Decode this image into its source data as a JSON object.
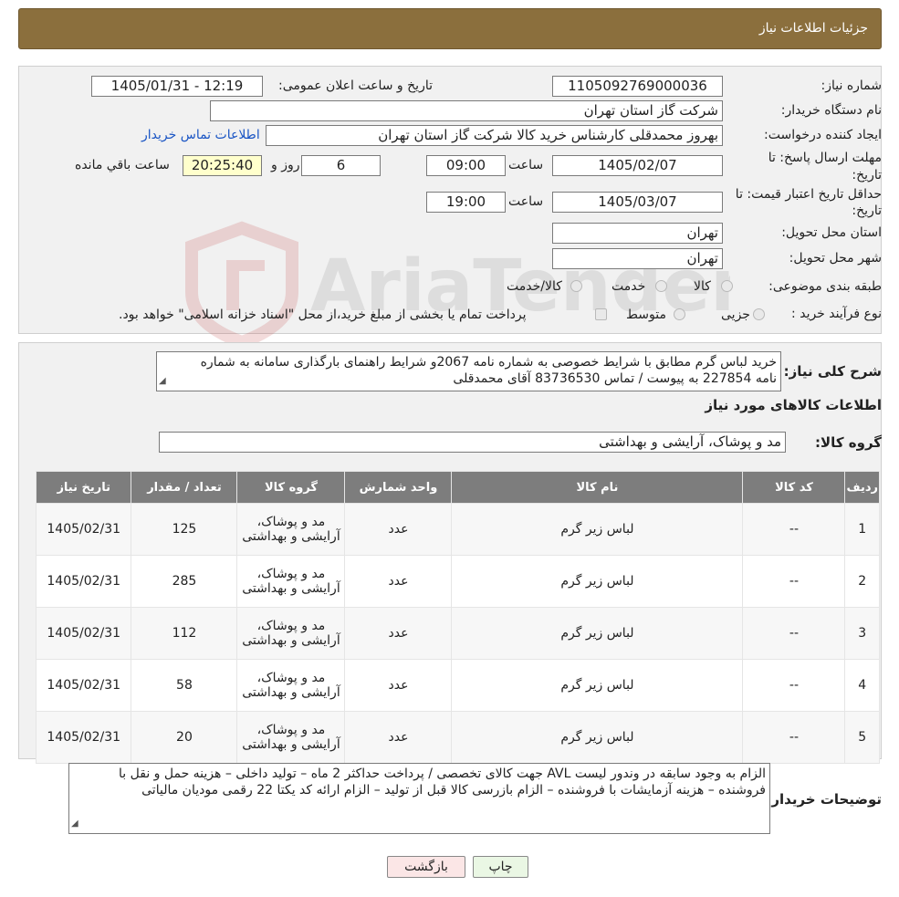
{
  "header": {
    "title": "جزئیات اطلاعات نیاز"
  },
  "fields": {
    "need_number_label": "شماره نیاز:",
    "need_number": "1105092769000036",
    "announce_label": "تاریخ و ساعت اعلان عمومی:",
    "announce_value": "1405/01/31 - 12:19",
    "buyer_org_label": "نام دستگاه خریدار:",
    "buyer_org": "شرکت گاز استان تهران",
    "creator_label": "ایجاد کننده درخواست:",
    "creator": "بهروز محمدقلی کارشناس خرید کالا شرکت گاز استان تهران",
    "contact_link": "اطلاعات تماس خریدار",
    "deadline_label_1": "مهلت ارسال پاسخ: تا",
    "deadline_label_2": "تاریخ:",
    "deadline_date": "1405/02/07",
    "time_label": "ساعت",
    "deadline_time": "09:00",
    "days_value": "6",
    "days_label": "روز و",
    "remaining_time": "20:25:40",
    "remaining_label": "ساعت باقي مانده",
    "validity_label_1": "حداقل تاريخ اعتبار قیمت: تا",
    "validity_label_2": "تاریخ:",
    "validity_date": "1405/03/07",
    "validity_time": "19:00",
    "province_label": "استان محل تحویل:",
    "province": "تهران",
    "city_label": "شهر محل تحویل:",
    "city": "تهران",
    "category_label": "طبقه بندی موضوعی:",
    "category_options": [
      "کالا",
      "خدمت",
      "کالا/خدمت"
    ],
    "process_label": "نوع فرآیند خرید :",
    "process_options": [
      "جزیی",
      "متوسط"
    ],
    "process_note": "پرداخت تمام یا بخشی از مبلغ خرید،از محل \"اسناد خزانه اسلامی\" خواهد بود."
  },
  "description": {
    "label": "شرح کلی نیاز:",
    "line1": "خرید  لباس گرم مطابق با شرایط خصوصی به شماره نامه 2067و شرایط راهنمای بارگذاری سامانه به شماره",
    "line2": "نامه 227854 به پیوست  / تماس 83736530 آقای محمدقلی"
  },
  "goods_info_title": "اطلاعات کالاهای مورد نیاز",
  "goods_group": {
    "label": "گروه کالا:",
    "value": "مد و پوشاک، آرایشی و بهداشتی"
  },
  "table": {
    "headers": [
      "ردیف",
      "کد کالا",
      "نام کالا",
      "واحد شمارش",
      "گروه کالا",
      "تعداد / مقدار",
      "تاریخ نیاز"
    ],
    "rows": [
      {
        "row": "1",
        "code": "--",
        "name": "لباس زیر گرم",
        "unit": "عدد",
        "group": "مد و پوشاک، آرایشی و بهداشتی",
        "qty": "125",
        "date": "1405/02/31"
      },
      {
        "row": "2",
        "code": "--",
        "name": "لباس زیر گرم",
        "unit": "عدد",
        "group": "مد و پوشاک، آرایشی و بهداشتی",
        "qty": "285",
        "date": "1405/02/31"
      },
      {
        "row": "3",
        "code": "--",
        "name": "لباس زیر گرم",
        "unit": "عدد",
        "group": "مد و پوشاک، آرایشی و بهداشتی",
        "qty": "112",
        "date": "1405/02/31"
      },
      {
        "row": "4",
        "code": "--",
        "name": "لباس زیر گرم",
        "unit": "عدد",
        "group": "مد و پوشاک، آرایشی و بهداشتی",
        "qty": "58",
        "date": "1405/02/31"
      },
      {
        "row": "5",
        "code": "--",
        "name": "لباس زیر گرم",
        "unit": "عدد",
        "group": "مد و پوشاک، آرایشی و بهداشتی",
        "qty": "20",
        "date": "1405/02/31"
      }
    ]
  },
  "buyer_notes": {
    "label": "توضیحات خریدار:",
    "line1": "الزام به وجود سابقه در وندور لیست AVL جهت کالای تخصصی / پرداخت حداکثر 2 ماه – تولید  داخلی – هزینه حمل و نقل با",
    "line2": "فروشنده – هزینه آزمایشات با فروشنده – الزام بازرسی کالا قبل از تولید – الزام ارائه  کد یکتا  22 رقمی مودیان مالیاتی"
  },
  "buttons": {
    "print": "چاپ",
    "back": "بازگشت"
  },
  "watermark_text": "AriaTender.neT",
  "colors": {
    "header_bg": "#8b6f3d",
    "table_header_bg": "#7d7d7d",
    "link": "#1a55c4",
    "print_bg": "#eaf7e4",
    "back_bg": "#fbe6e6"
  }
}
